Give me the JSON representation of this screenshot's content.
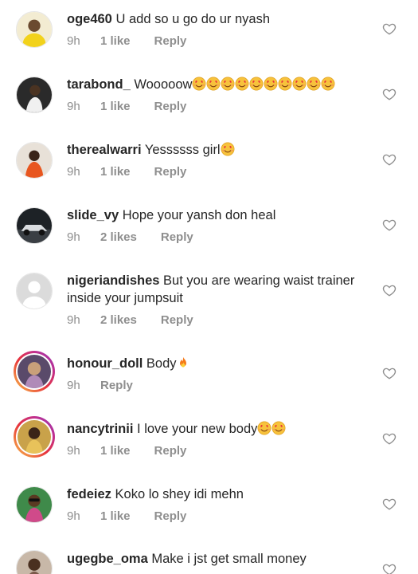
{
  "comments": [
    {
      "username": "oge460",
      "text": "U add so u go do ur nyash",
      "time": "9h",
      "likes": "1 like",
      "reply": "Reply",
      "emoji": [],
      "story_ring": false,
      "avatar_icon": "avatar-photo-yellow"
    },
    {
      "username": "tarabond_",
      "text": "Wooooow",
      "time": "9h",
      "likes": "1 like",
      "reply": "Reply",
      "emoji": [
        "heart-eyes-emoji",
        "heart-eyes-emoji",
        "heart-eyes-emoji",
        "heart-eyes-emoji",
        "heart-eyes-emoji",
        "heart-eyes-emoji",
        "heart-eyes-emoji",
        "heart-eyes-emoji",
        "heart-eyes-emoji",
        "heart-eyes-emoji"
      ],
      "story_ring": false,
      "avatar_icon": "avatar-photo-dark"
    },
    {
      "username": "therealwarri",
      "text": "Yessssss girl",
      "time": "9h",
      "likes": "1 like",
      "reply": "Reply",
      "emoji": [
        "heart-eyes-emoji"
      ],
      "story_ring": false,
      "avatar_icon": "avatar-photo-orange"
    },
    {
      "username": "slide_vy",
      "text": "Hope your yansh don heal",
      "time": "9h",
      "likes": "2 likes",
      "reply": "Reply",
      "emoji": [],
      "story_ring": false,
      "avatar_icon": "avatar-photo-car"
    },
    {
      "username": "nigeriandishes",
      "text": "But you are wearing waist trainer inside your jumpsuit",
      "time": "9h",
      "likes": "2 likes",
      "reply": "Reply",
      "emoji": [],
      "story_ring": false,
      "avatar_icon": "avatar-default-gray"
    },
    {
      "username": "honour_doll",
      "text": "Body",
      "time": "9h",
      "likes": "",
      "reply": "Reply",
      "emoji": [
        "fire-emoji"
      ],
      "story_ring": true,
      "avatar_icon": "avatar-photo-purple"
    },
    {
      "username": "nancytrinii",
      "text": "I love your new body",
      "time": "9h",
      "likes": "1 like",
      "reply": "Reply",
      "emoji": [
        "heart-eyes-emoji",
        "heart-eyes-emoji"
      ],
      "story_ring": true,
      "avatar_icon": "avatar-photo-gold"
    },
    {
      "username": "fedeiez",
      "text": "Koko lo shey idi mehn",
      "time": "9h",
      "likes": "1 like",
      "reply": "Reply",
      "emoji": [],
      "story_ring": false,
      "avatar_icon": "avatar-photo-green"
    },
    {
      "username": "ugegbe_oma",
      "text": "Make i jst get small money",
      "time": "",
      "likes": "",
      "reply": "",
      "emoji": [],
      "story_ring": false,
      "avatar_icon": "avatar-photo-brown"
    }
  ],
  "colors": {
    "text": "#262626",
    "meta": "#8e8e8e",
    "heart_outline": "#8e8e8e",
    "story_ring_start": "#f9c34a",
    "story_ring_end": "#8a38b9"
  }
}
